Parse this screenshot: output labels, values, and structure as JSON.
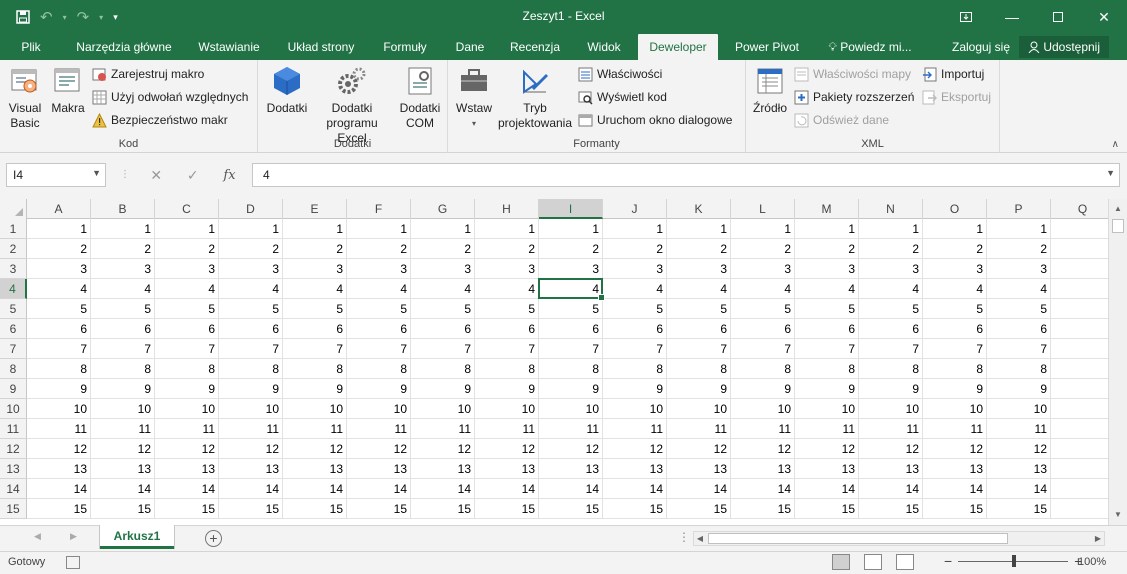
{
  "app": {
    "title": "Zeszyt1 - Excel"
  },
  "qat": {
    "save_icon": "save-icon",
    "undo_icon": "undo-icon",
    "redo_icon": "redo-icon",
    "customize_icon": "customize-icon"
  },
  "tabs": [
    {
      "label": "Plik"
    },
    {
      "label": "Narzędzia główne"
    },
    {
      "label": "Wstawianie"
    },
    {
      "label": "Układ strony"
    },
    {
      "label": "Formuły"
    },
    {
      "label": "Dane"
    },
    {
      "label": "Recenzja"
    },
    {
      "label": "Widok"
    },
    {
      "label": "Deweloper",
      "active": true
    },
    {
      "label": "Power Pivot"
    },
    {
      "label": "Powiedz mi..."
    },
    {
      "label": "Zaloguj się"
    }
  ],
  "share_label": "Udostępnij",
  "ribbon": {
    "kod": {
      "label": "Kod",
      "visual_basic": "Visual Basic",
      "makra": "Makra",
      "record": "Zarejestruj makro",
      "relative": "Użyj odwołań względnych",
      "security": "Bezpieczeństwo makr"
    },
    "dodatki": {
      "label": "Dodatki",
      "dodatki": "Dodatki",
      "excel_addins": "Dodatki programu Excel",
      "com_addins": "Dodatki COM"
    },
    "formanty": {
      "label": "Formanty",
      "insert": "Wstaw",
      "design_mode": "Tryb projektowania",
      "properties": "Właściwości",
      "view_code": "Wyświetl kod",
      "run_dialog": "Uruchom okno dialogowe"
    },
    "xml": {
      "label": "XML",
      "source": "Źródło",
      "map_properties": "Właściwości mapy",
      "expansion_packs": "Pakiety rozszerzeń",
      "refresh_data": "Odśwież dane",
      "import": "Importuj",
      "export": "Eksportuj"
    }
  },
  "formula_bar": {
    "name_box": "I4",
    "formula": "4"
  },
  "sheet": {
    "columns": [
      "A",
      "B",
      "C",
      "D",
      "E",
      "F",
      "G",
      "H",
      "I",
      "J",
      "K",
      "L",
      "M",
      "N",
      "O",
      "P",
      "Q"
    ],
    "selected_column": "I",
    "selected_row": 4,
    "rows": [
      1,
      2,
      3,
      4,
      5,
      6,
      7,
      8,
      9,
      10,
      11,
      12,
      13,
      14,
      15
    ],
    "partial_col_q_value": "1"
  },
  "sheet_tabs": {
    "active": "Arkusz1"
  },
  "status": {
    "ready": "Gotowy",
    "zoom": "100%"
  }
}
